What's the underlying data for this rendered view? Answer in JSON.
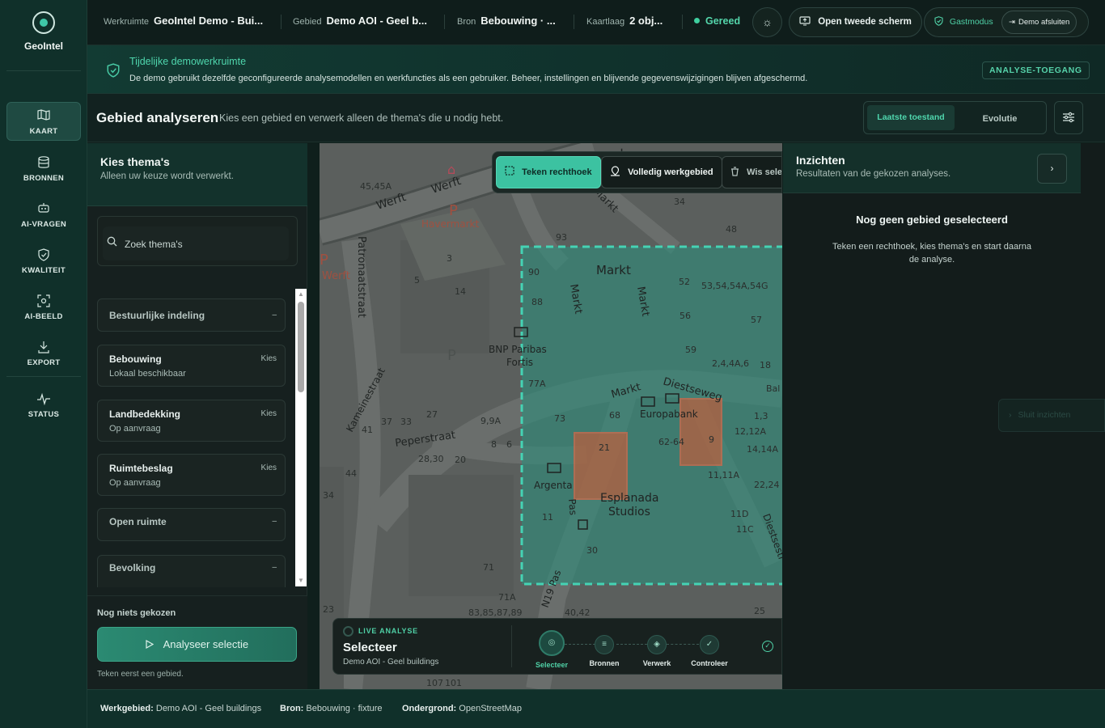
{
  "app": {
    "name": "GeoIntel"
  },
  "sidebar": {
    "items": [
      {
        "label": "KAART",
        "icon": "map-icon",
        "active": true
      },
      {
        "label": "BRONNEN",
        "icon": "database-icon"
      },
      {
        "label": "AI-VRAGEN",
        "icon": "robot-icon"
      },
      {
        "label": "KWALITEIT",
        "icon": "shield-check-icon"
      },
      {
        "label": "AI-BEELD",
        "icon": "scan-image-icon"
      },
      {
        "label": "EXPORT",
        "icon": "download-icon"
      },
      {
        "label": "STATUS",
        "icon": "pulse-icon"
      }
    ]
  },
  "topbar": {
    "workspace_key": "Werkruimte",
    "workspace_val": "GeoIntel Demo - Bui...",
    "area_key": "Gebied",
    "area_val": "Demo AOI - Geel b...",
    "source_key": "Bron",
    "source_val": "Bebouwing · ...",
    "layer_key": "Kaartlaag",
    "layer_val": "2 obj...",
    "status": "Gereed",
    "second_screen": "Open tweede scherm",
    "guest": "Gastmodus",
    "close_demo": "Demo afsluiten"
  },
  "banner": {
    "title": "Tijdelijke demowerkruimte",
    "text": "De demo gebruikt dezelfde geconfigureerde analysemodellen en werkfuncties als een gebruiker. Beheer, instellingen en blijvende gegevenswijzigingen blijven afgeschermd.",
    "badge": "ANALYSE-TOEGANG"
  },
  "heading": {
    "title": "Gebied analyseren",
    "subtitle": "Kies een gebied en verwerk alleen de thema's die u nodig hebt.",
    "tab_latest": "Laatste toestand",
    "tab_evolution": "Evolutie"
  },
  "themes": {
    "title": "Kies thema's",
    "subtitle": "Alleen uw keuze wordt verwerkt.",
    "search_placeholder": "Zoek thema's",
    "items": [
      {
        "name": "Bestuurlijke indeling",
        "sub": "",
        "action": "–"
      },
      {
        "name": "Bebouwing",
        "sub": "Lokaal beschikbaar",
        "action": "Kies"
      },
      {
        "name": "Landbedekking",
        "sub": "Op aanvraag",
        "action": "Kies"
      },
      {
        "name": "Ruimtebeslag",
        "sub": "Op aanvraag",
        "action": "Kies"
      },
      {
        "name": "Open ruimte",
        "sub": "",
        "action": "–"
      },
      {
        "name": "Bevolking",
        "sub": "",
        "action": "–"
      }
    ],
    "nothing_chosen": "Nog niets gekozen",
    "analyse_button": "Analyseer selectie",
    "hint": "Teken eerst een gebied."
  },
  "map_toolbar": {
    "draw_rect": "Teken rechthoek",
    "full_area": "Volledig werkgebied",
    "clear": "Wis selectie"
  },
  "map_labels": {
    "werft1": "Werft",
    "werft2": "Werft",
    "werft3": "Werft",
    "havermarkt": "Havermarkt",
    "patronaatstraat": "Patronaatstraat",
    "markt1": "Markt",
    "markt2": "Markt",
    "markt3": "Markt",
    "markt4": "Markt",
    "markt5": "Markt",
    "bnp": "BNP Paribas",
    "fortis": "Fortis",
    "diestseweg": "Diestseweg",
    "europabank": "Europabank",
    "kameinestraat": "Kameinestraat",
    "peperstraat": "Peperstraat",
    "argenta": "Argenta",
    "esplanada": "Esplanada",
    "studios": "Studios",
    "n19": "N19 Pas",
    "pas": "Pas",
    "diestsestr": "Diestsestr",
    "hn_45": "45,45A",
    "hn_93": "93",
    "hn_90": "90",
    "hn_88": "88",
    "hn_34": "34",
    "hn_48": "48",
    "hn_52": "52",
    "hn_53": "53,54,54A,54G",
    "hn_56": "56",
    "hn_57": "57",
    "hn_59": "59",
    "hn_2": "2,4,4A,6",
    "hn_18": "18",
    "hn_77": "77A",
    "hn_73": "73",
    "hn_68": "68",
    "hn_62": "62-64",
    "hn_9": "9",
    "hn_13": "1,3",
    "hn_12": "12,12A",
    "hn_14": "14,14A",
    "hn_11": "11,11A",
    "hn_22": "22,24",
    "hn_11d": "11D",
    "hn_11c": "11C",
    "hn_37": "37",
    "hn_33": "33",
    "hn_27": "27",
    "hn_99": "9,9A",
    "hn_41": "41",
    "hn_28": "28,30",
    "hn_20": "20",
    "hn_8": "8",
    "hn_6": "6",
    "hn_44": "44",
    "hn_34b": "34",
    "hn_71": "71",
    "hn_71a": "71A",
    "hn_83": "83,85,87,89",
    "hn_40": "40,42",
    "hn_23": "23",
    "hn_25": "25",
    "hn_107": "107",
    "hn_101": "101",
    "hn_30": "30",
    "hn_21": "21",
    "hn_3": "3",
    "hn_14b": "14",
    "hn_5": "5",
    "hn_11e": "11",
    "hn_bal": "Bal"
  },
  "live": {
    "tag": "LIVE ANALYSE",
    "title": "Selecteer",
    "subtitle": "Demo AOI - Geel buildings",
    "steps": [
      "Selecteer",
      "Bronnen",
      "Verwerk",
      "Controleer"
    ]
  },
  "insights": {
    "title": "Inzichten",
    "subtitle": "Resultaten van de gekozen analyses.",
    "empty_title": "Nog geen gebied geselecteerd",
    "empty_text": "Teken een rechthoek, kies thema's en start daarna de analyse.",
    "close": "Sluit inzichten"
  },
  "footer": {
    "area_key": "Werkgebied:",
    "area_val": "Demo AOI - Geel buildings",
    "source_key": "Bron:",
    "source_val": "Bebouwing · fixture",
    "base_key": "Ondergrond:",
    "base_val": "OpenStreetMap"
  }
}
